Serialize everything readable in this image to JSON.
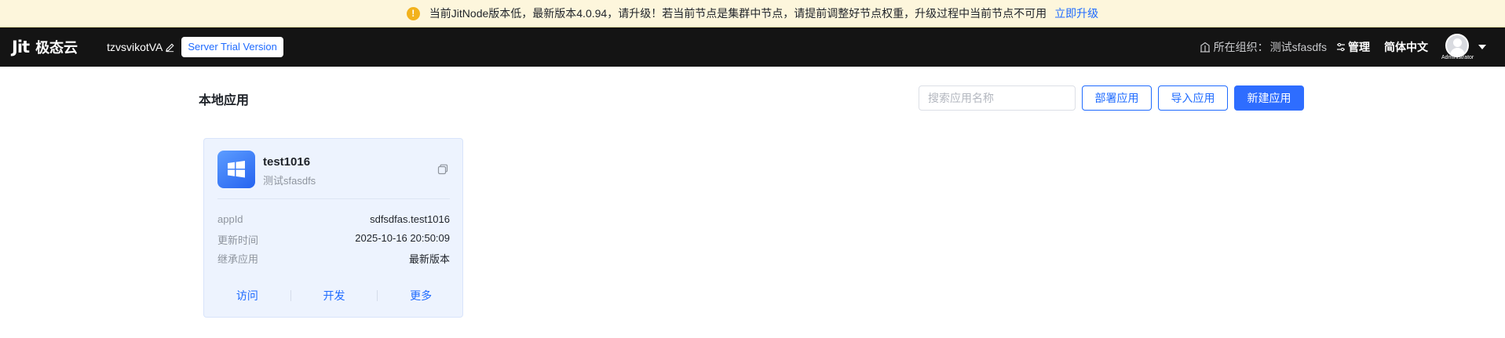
{
  "banner": {
    "message": "当前JitNode版本低，最新版本4.0.94，请升级！若当前节点是集群中节点，请提前调整好节点权重，升级过程中当前节点不可用",
    "link": "立即升级",
    "icon": "warning-icon"
  },
  "header": {
    "logo_mark": "Jit",
    "logo_text": "极态云",
    "user_name": "tzvsvikotVA",
    "trial_badge": "Server Trial Version",
    "org_label": "所在组织：",
    "org_name": "测试sfasdfs",
    "manage": "管理",
    "language": "简体中文",
    "avatar_role": "Administrator"
  },
  "main": {
    "title": "本地应用",
    "search_placeholder": "搜索应用名称",
    "buttons": {
      "deploy": "部署应用",
      "import": "导入应用",
      "create": "新建应用"
    }
  },
  "apps": [
    {
      "name": "test1016",
      "org": "测试sfasdfs",
      "fields": [
        {
          "label": "appId",
          "value": "sdfsdfas.test1016"
        },
        {
          "label": "更新时间",
          "value": "2025-10-16 20:50:09"
        },
        {
          "label": "继承应用",
          "value": "最新版本"
        }
      ],
      "actions": {
        "visit": "访问",
        "develop": "开发",
        "more": "更多"
      }
    }
  ],
  "colors": {
    "accent": "#1f6bff",
    "banner_bg": "#fdf6dc",
    "topbar_bg": "#141414",
    "card_bg": "#edf3fe"
  }
}
